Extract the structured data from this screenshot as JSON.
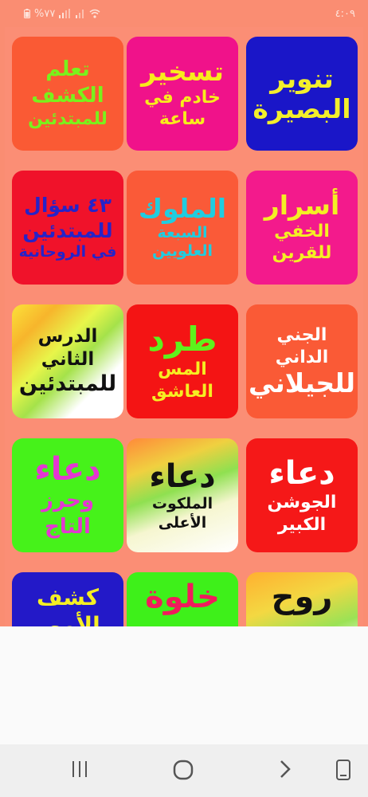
{
  "status_bar": {
    "time": "٤:٠٩",
    "battery": "%٧٧"
  },
  "tiles": [
    {
      "line1": "تنوير",
      "line2": "البصيرة",
      "bg": "#1a16c8",
      "fg1": "#f3ef2b",
      "fg2": "#f3ef2b"
    },
    {
      "line1": "تسخير",
      "line2": "خادم في ساعة",
      "bg": "#f0128a",
      "fg1": "#f8ec1c",
      "fg2": "#f8ec1c"
    },
    {
      "line1": "تعلم",
      "line2": "الكشف",
      "line3": "للمبتدئين",
      "bg": "#fa5a34",
      "fg1": "#79f21c",
      "fg2": "#79f21c",
      "fg3": "#79f21c"
    },
    {
      "line1": "أسرار",
      "line2": "الخفي للقرين",
      "bg": "#f31a8c",
      "fg1": "#f4ef24",
      "fg2": "#f4ef24"
    },
    {
      "line1": "الملوك",
      "line2": "السبعة العلويين",
      "bg": "#fa5a38",
      "fg1": "#1fcde0",
      "fg2": "#1fcde0"
    },
    {
      "line1": "٤٣ سؤال",
      "line2": "للمبتدئين",
      "line3": "في الروحانية",
      "bg": "#f0122a",
      "fg1": "#2623c8",
      "fg2": "#2623c8",
      "fg3": "#2623c8"
    },
    {
      "line1": "الجني الداني",
      "line2": "للجيلاني",
      "bg": "#fa5a36",
      "fg1": "#ffffff",
      "fg2": "#ffffff"
    },
    {
      "line1": "طرد",
      "line2": "المس العاشق",
      "bg": "#f41414",
      "fg1": "#5ef21c",
      "fg2": "#f6ee22"
    },
    {
      "line1": "الدرس الثاني",
      "line2": "للمبتدئين",
      "bg": "gradient-rainbow",
      "fg1": "#111111",
      "fg2": "#111111"
    },
    {
      "line1": "دعاء",
      "line2": "الجوشن الكبير",
      "bg": "#f51818",
      "fg1": "#ffffff",
      "fg2": "#ffffff"
    },
    {
      "line1": "دعاء",
      "line2": "الملكوت الأعلى",
      "bg": "gradient-rainbow",
      "fg1": "#111111",
      "fg2": "#111111"
    },
    {
      "line1": "دعاء",
      "line2": "وحرز التاج",
      "bg": "#46f21a",
      "fg1": "#e436d2",
      "fg2": "#e436d2"
    },
    {
      "line1": "روح",
      "line2": "",
      "bg": "gradient-rainbow",
      "fg1": "#111111",
      "fg2": "#111111"
    },
    {
      "line1": "خلوة",
      "line2": "",
      "bg": "#3ef01a",
      "fg1": "#f01b5c",
      "fg2": "#f01b5c"
    },
    {
      "line1": "كشف الأمور",
      "line2": "",
      "bg": "#2319c8",
      "fg1": "#f5ef24",
      "fg2": "#f5ef24"
    }
  ]
}
